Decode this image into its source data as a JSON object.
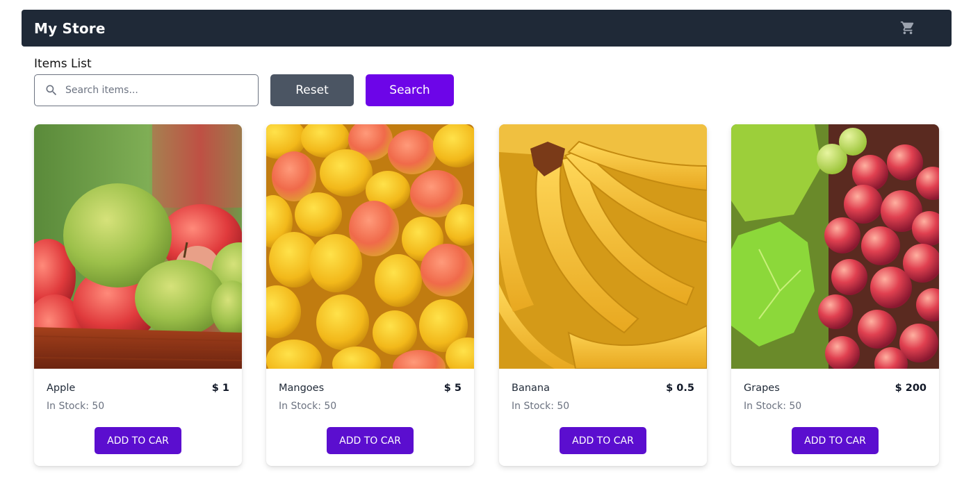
{
  "header": {
    "brand": "My Store",
    "cart_icon": "shopping-cart-icon"
  },
  "section": {
    "title": "Items List"
  },
  "search": {
    "placeholder": "Search items...",
    "value": "",
    "icon": "search-icon"
  },
  "buttons": {
    "reset_label": "Reset",
    "search_label": "Search"
  },
  "colors": {
    "navbar": "#1f2937",
    "reset": "#4b5563",
    "search": "#6d05e8",
    "add_to_cart": "#5b0ecf"
  },
  "products": [
    {
      "name": "Apple",
      "price": "$ 1",
      "stock": "In Stock: 50",
      "button": "ADD TO CAR",
      "image": "apple-photo"
    },
    {
      "name": "Mangoes",
      "price": "$ 5",
      "stock": "In Stock: 50",
      "button": "ADD TO CAR",
      "image": "mangoes-photo"
    },
    {
      "name": "Banana",
      "price": "$ 0.5",
      "stock": "In Stock: 50",
      "button": "ADD TO CAR",
      "image": "banana-photo"
    },
    {
      "name": "Grapes",
      "price": "$ 200",
      "stock": "In Stock: 50",
      "button": "ADD TO CAR",
      "image": "grapes-photo"
    }
  ]
}
